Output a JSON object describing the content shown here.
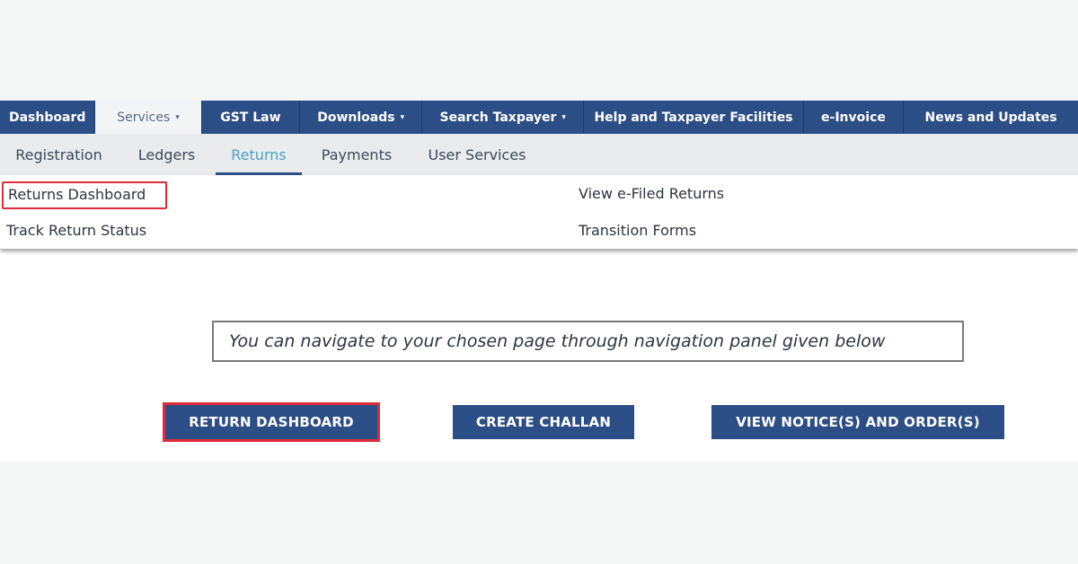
{
  "top_nav": {
    "items": [
      {
        "label": "Dashboard"
      },
      {
        "label": "Services",
        "has_caret": true,
        "active": true
      },
      {
        "label": "GST Law"
      },
      {
        "label": "Downloads",
        "has_caret": true
      },
      {
        "label": "Search Taxpayer",
        "has_caret": true
      },
      {
        "label": "Help and Taxpayer Facilities"
      },
      {
        "label": "e-Invoice"
      },
      {
        "label": "News and Updates"
      }
    ],
    "caret_glyph": "▾"
  },
  "sub_nav": {
    "items": [
      {
        "label": "Registration"
      },
      {
        "label": "Ledgers"
      },
      {
        "label": "Returns",
        "active": true
      },
      {
        "label": "Payments"
      },
      {
        "label": "User Services"
      }
    ]
  },
  "returns_menu": {
    "items": [
      {
        "label": "Returns Dashboard",
        "highlighted": true
      },
      {
        "label": "Track Return Status"
      },
      {
        "label": "View e-Filed Returns"
      },
      {
        "label": "Transition Forms"
      }
    ]
  },
  "info_text": "You can navigate to your chosen page through navigation panel given below",
  "buttons": [
    {
      "label": "RETURN DASHBOARD",
      "highlighted": true
    },
    {
      "label": "CREATE CHALLAN"
    },
    {
      "label": "VIEW NOTICE(S) AND ORDER(S)"
    }
  ],
  "colors": {
    "nav_blue": "#2c4e86",
    "highlight_red": "#e02b3a",
    "active_subnav_text": "#4ba3c3"
  }
}
